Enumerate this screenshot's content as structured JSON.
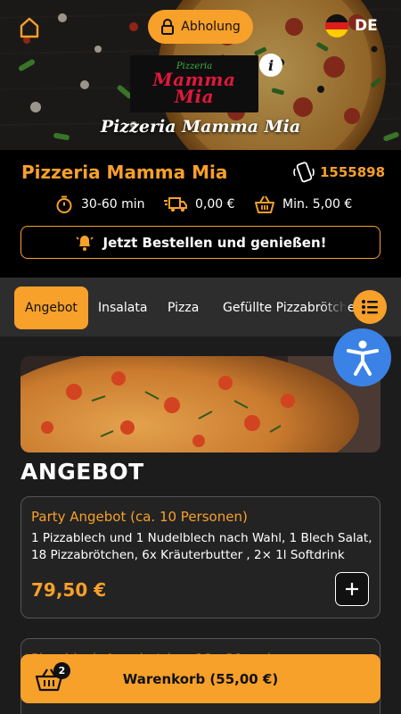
{
  "header": {
    "pickup_label": "Abholung",
    "language_label": "DE",
    "logo_top": "Pizzeria",
    "logo_line1": "Mamma",
    "logo_line2": "Mia",
    "banner_caption": "Pizzeria Mamma Mia",
    "info_glyph": "i"
  },
  "restaurant": {
    "name": "Pizzeria Mamma Mia",
    "phone": "1555898",
    "delivery_time": "30-60 min",
    "delivery_fee": "0,00 €",
    "min_order": "Min. 5,00 €",
    "order_cta": "Jetzt Bestellen und genießen!"
  },
  "categories": [
    {
      "label": "Angebot",
      "active": true
    },
    {
      "label": "Insalata",
      "active": false
    },
    {
      "label": "Pizza",
      "active": false
    },
    {
      "label": "Gefüllte Pizzabrötchen",
      "active": false
    }
  ],
  "section": {
    "title": "ANGEBOT"
  },
  "products": [
    {
      "name": "Party Angebot (ca. 10 Personen)",
      "description": "1 Pizzablech und 1 Nudelblech nach Wahl, 1 Blech Salat, 18 Pizzabrötchen, 6x Kräuterbutter , 2× 1l Softdrink",
      "price": "79,50 €"
    },
    {
      "name": "Pizzablech Angebot (ca. 10 - 20 cm)",
      "description": "",
      "price": ""
    }
  ],
  "cart": {
    "label": "Warenkorb (55,00 €)",
    "count": "2"
  },
  "colors": {
    "accent": "#f7a02a",
    "background": "#000000",
    "surface": "#1c1c1c",
    "card": "#232323",
    "accessibility": "#3b82e6",
    "logo_red": "#e0183c",
    "logo_green": "#3fb04a"
  },
  "icons": {
    "home": "home-icon",
    "lock": "lock-icon",
    "flag": "german-flag-icon",
    "info": "info-icon",
    "phone": "phone-icon",
    "timer": "timer-icon",
    "delivery": "delivery-truck-icon",
    "basket": "basket-icon",
    "bell": "bell-icon",
    "list": "list-icon",
    "accessibility": "accessibility-icon",
    "plus": "plus-icon",
    "cart": "cart-icon"
  }
}
